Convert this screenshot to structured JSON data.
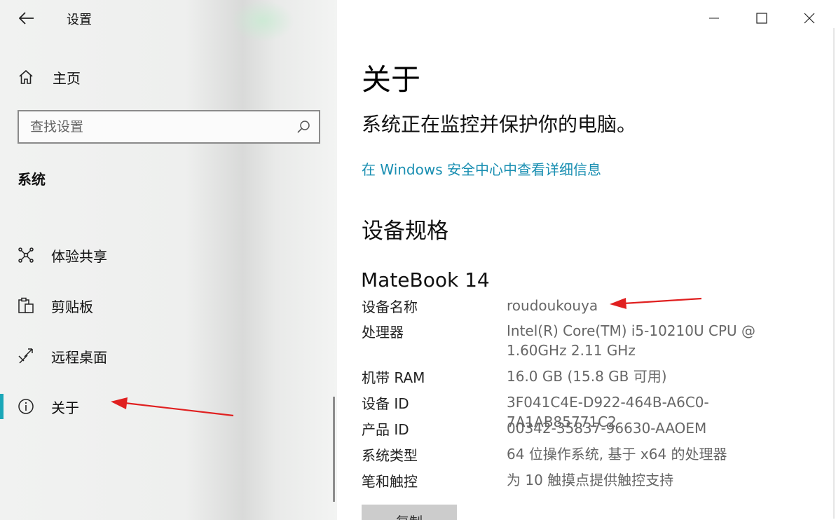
{
  "window": {
    "title": "设置",
    "controls": {
      "minimize": "minimize-icon",
      "maximize": "maximize-icon",
      "close": "close-icon"
    }
  },
  "sidebar": {
    "home_label": "主页",
    "search_placeholder": "查找设置",
    "section_label": "系统",
    "items": [
      {
        "label": "体验共享",
        "icon": "share-network-icon"
      },
      {
        "label": "剪贴板",
        "icon": "clipboard-icon"
      },
      {
        "label": "远程桌面",
        "icon": "remote-desktop-icon"
      },
      {
        "label": "关于",
        "icon": "info-icon",
        "selected": true
      }
    ]
  },
  "main": {
    "title": "关于",
    "protection_text": "系统正在监控并保护你的电脑。",
    "security_link": "在 Windows 安全中心中查看详细信息",
    "spec_title": "设备规格",
    "device_model": "MateBook 14",
    "specs": [
      {
        "key": "设备名称",
        "value": "roudoukouya"
      },
      {
        "key": "处理器",
        "value": "Intel(R) Core(TM) i5-10210U CPU @ 1.60GHz 2.11 GHz"
      },
      {
        "key": "机带 RAM",
        "value": "16.0 GB (15.8 GB 可用)"
      },
      {
        "key": "设备 ID",
        "value": "3F041C4E-D922-464B-A6C0-7A1AB85771C2"
      },
      {
        "key": "产品 ID",
        "value": "00342-35837-96630-AAOEM"
      },
      {
        "key": "系统类型",
        "value": "64 位操作系统, 基于 x64 的处理器"
      },
      {
        "key": "笔和触控",
        "value": "为 10 触摸点提供触控支持"
      }
    ],
    "copy_button": "复制"
  },
  "colors": {
    "accent": "#1aa7b8",
    "link": "#1a8fb2",
    "annotation_arrow": "#e02020"
  }
}
